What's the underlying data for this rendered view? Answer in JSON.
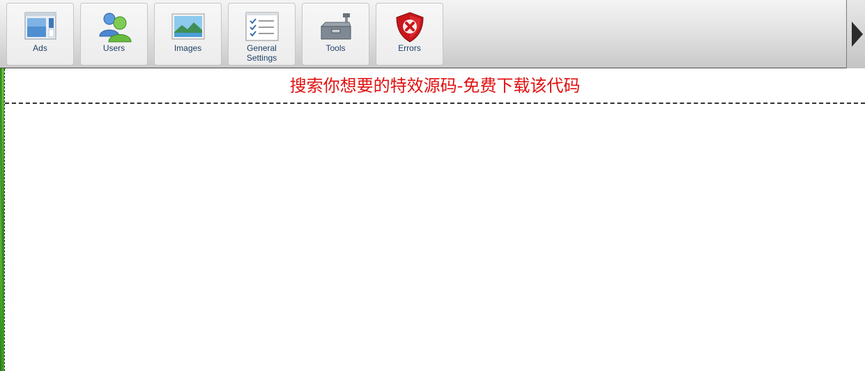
{
  "toolbar": {
    "items": [
      {
        "label": "Ads",
        "icon": "ads-window-icon"
      },
      {
        "label": "Users",
        "icon": "users-icon"
      },
      {
        "label": "Images",
        "icon": "landscape-image-icon"
      },
      {
        "label": "General\nSettings",
        "icon": "checklist-icon"
      },
      {
        "label": "Tools",
        "icon": "toolbox-icon"
      },
      {
        "label": "Errors",
        "icon": "error-shield-icon"
      }
    ],
    "scroll_icon": "arrow-right-icon"
  },
  "banner": {
    "text": "搜索你想要的特效源码-免费下载该代码",
    "color": "#e01010"
  }
}
